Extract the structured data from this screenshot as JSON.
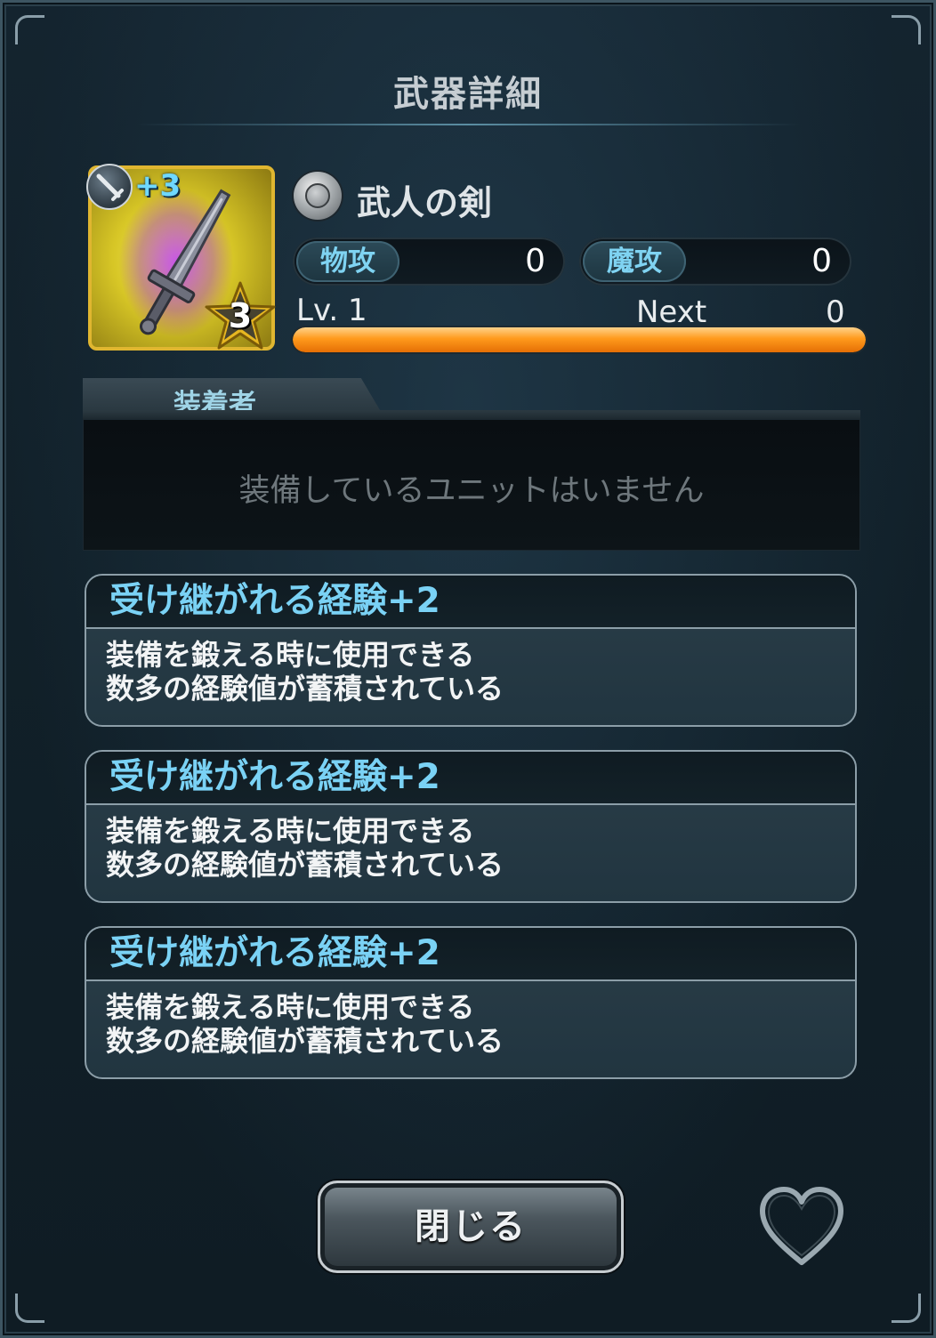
{
  "header": {
    "title": "武器詳細"
  },
  "weapon": {
    "plus": "+3",
    "rarity_stars": "3",
    "name": "武人の剣",
    "stats": [
      {
        "label": "物攻",
        "value": "0"
      },
      {
        "label": "魔攻",
        "value": "0"
      }
    ],
    "level": "Lv. 1",
    "next_label": "Next",
    "next_value": "0",
    "exp_progress": 1.0
  },
  "equipped": {
    "tab_label": "装着者",
    "empty_message": "装備しているユニットはいません"
  },
  "abilities": [
    {
      "name": "受け継がれる経験+2",
      "description": "装備を鍛える時に使用できる\n数多の経験値が蓄積されている"
    },
    {
      "name": "受け継がれる経験+2",
      "description": "装備を鍛える時に使用できる\n数多の経験値が蓄積されている"
    },
    {
      "name": "受け継がれる経験+2",
      "description": "装備を鍛える時に使用できる\n数多の経験値が蓄積されている"
    }
  ],
  "footer": {
    "close_label": "閉じる"
  },
  "icons": {
    "weapon_type": "sword-type-icon",
    "weapon_art": "sword-icon",
    "rarity": "rarity-orb-icon",
    "favorite": "heart-icon"
  },
  "colors": {
    "accent": "#7ad2f5",
    "exp_bar": "#ff9a1c",
    "icon_frame": "#e0b630"
  }
}
